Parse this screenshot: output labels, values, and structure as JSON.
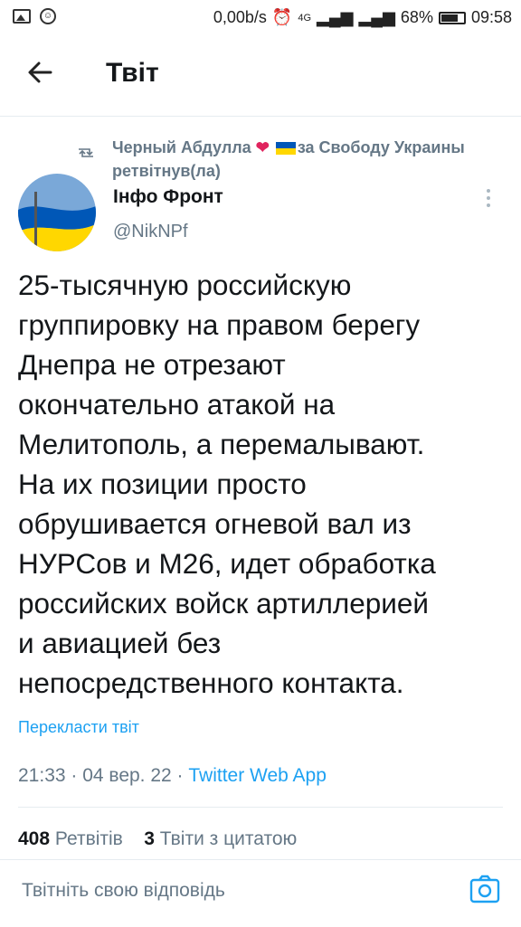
{
  "status_bar": {
    "speed": "0,00b/s",
    "network": "4G",
    "battery": "68%",
    "battery_level": 0.68,
    "time": "09:58"
  },
  "header": {
    "back_icon": "arrow-left-icon",
    "title": "Твіт"
  },
  "retweet": {
    "icon": "retweet-icon",
    "user": "Черный Абдулла",
    "user_suffix": "за Свободу Украины",
    "action": "ретвітнув(ла)"
  },
  "author": {
    "name": "Інфо Фронт",
    "handle": "@NikNPf"
  },
  "tweet": {
    "text": "25-тысячную российскую\nгруппировку на правом берегу\nДнепра не отрезают\nокончательно атакой на\nМелитополь, а перемалывают.\nНа их позиции просто\nобрушивается огневой вал из\nНУРСов и М26, идет обработка\nроссийских войск артиллерией\nи авиацией без\nнепосредственного контакта.",
    "translate": "Перекласти твіт",
    "time": "21:33 · 04 вер. 22 · ",
    "app": "Twitter Web App"
  },
  "stats": {
    "retweets_count": "408",
    "retweets_label": "Ретвітів",
    "quotes_count": "3",
    "quotes_label": "Твіти з цитатою"
  },
  "reply": {
    "placeholder": "Твітніть свою відповідь",
    "camera_icon": "camera-icon"
  },
  "colors": {
    "accent": "#1da1f2",
    "secondary_text": "#657786",
    "heart": "#e0245e",
    "flag_blue": "#0057b7",
    "flag_yellow": "#ffd700"
  }
}
